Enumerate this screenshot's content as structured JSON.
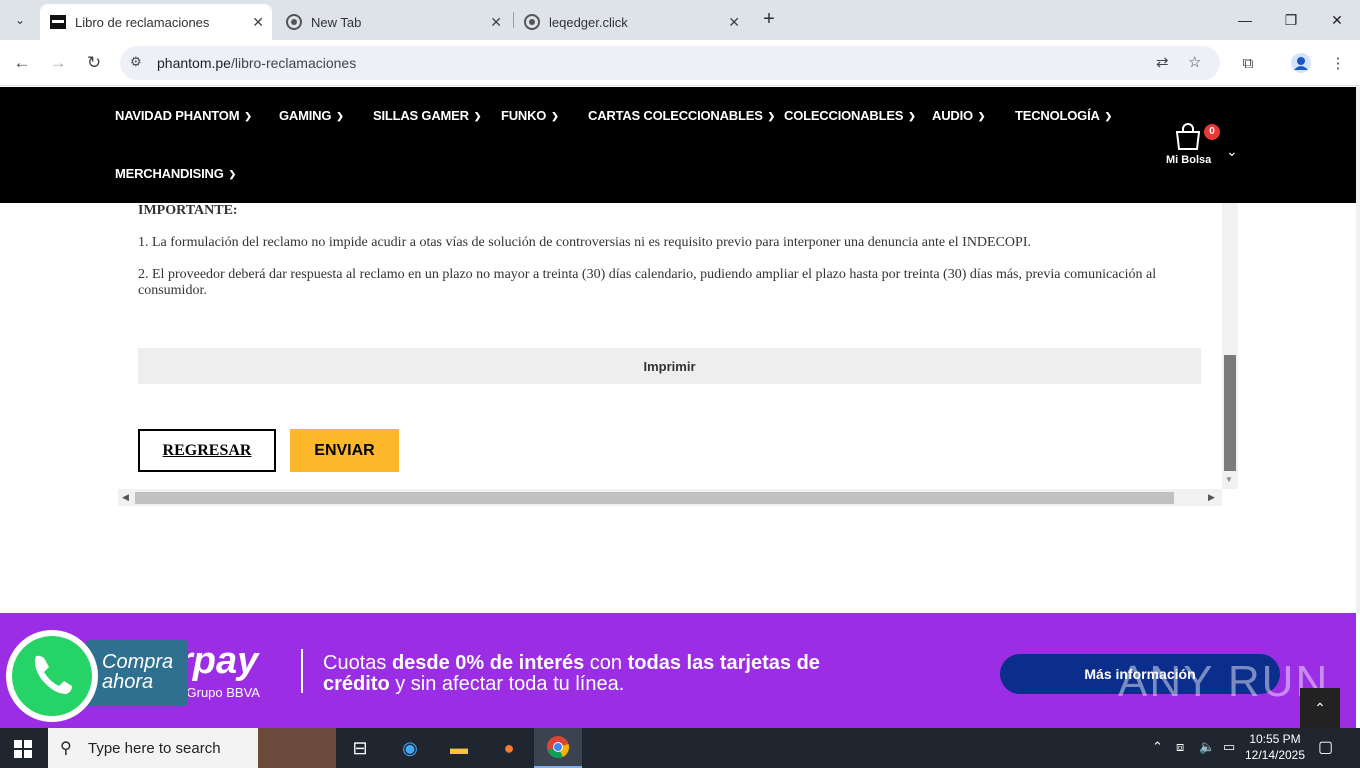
{
  "browser": {
    "tabs": [
      {
        "title": "Libro de reclamaciones",
        "active": true
      },
      {
        "title": "New Tab",
        "active": false
      },
      {
        "title": "leqedger.click",
        "active": false
      }
    ],
    "url_host": "phantom.pe",
    "url_path": "/libro-reclamaciones"
  },
  "site": {
    "menu": [
      "NAVIDAD PHANTOM",
      "GAMING",
      "SILLAS GAMER",
      "FUNKO",
      "CARTAS COLECCIONABLES",
      "COLECCIONABLES",
      "AUDIO",
      "TECNOLOGÍA",
      "MERCHANDISING"
    ],
    "cart_count": "0",
    "cart_label": "Mi Bolsa"
  },
  "content": {
    "important_title": "IMPORTANTE:",
    "note_1": "1. La formulación del reclamo no impide acudir a otas vías de solución de controversias ni es requisito previo para interponer una denuncia ante el INDECOPI.",
    "note_2": "2. El proveedor deberá dar respuesta al reclamo en un plazo no mayor a treinta (30) días calendario, pudiendo ampliar el plazo hasta por treinta (30) días más, previa comunicación al consumidor.",
    "print_label": "Imprimir",
    "back_label": "REGRESAR",
    "send_label": "ENVIAR"
  },
  "promo": {
    "brand": "rpay",
    "grupo": "l Grupo BBVA",
    "text_a": "Cuotas ",
    "text_b": "desde 0% de interés",
    "text_c": " con ",
    "text_d": "todas las tarjetas de crédito",
    "text_e": " y sin afectar toda tu línea.",
    "info_button": "Más información",
    "whatsapp_label": "Compra ahora",
    "watermark": "ANY RUN"
  },
  "taskbar": {
    "search_placeholder": "Type here to search",
    "time": "10:55 PM",
    "date": "12/14/2025"
  },
  "colors": {
    "header_bg": "#000000",
    "send_button": "#fcb72b",
    "promo_bg": "#9b2de4",
    "info_button": "#0b2d8c"
  }
}
